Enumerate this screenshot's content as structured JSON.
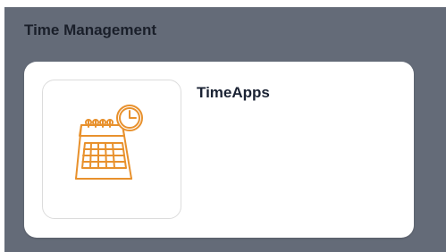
{
  "section": {
    "title": "Time Management"
  },
  "tile": {
    "title": "TimeApps",
    "icon": "calendar-clock-icon",
    "icon_color": "#e8912d"
  },
  "colors": {
    "panel_background": "#646b78",
    "tile_background": "#ffffff"
  }
}
